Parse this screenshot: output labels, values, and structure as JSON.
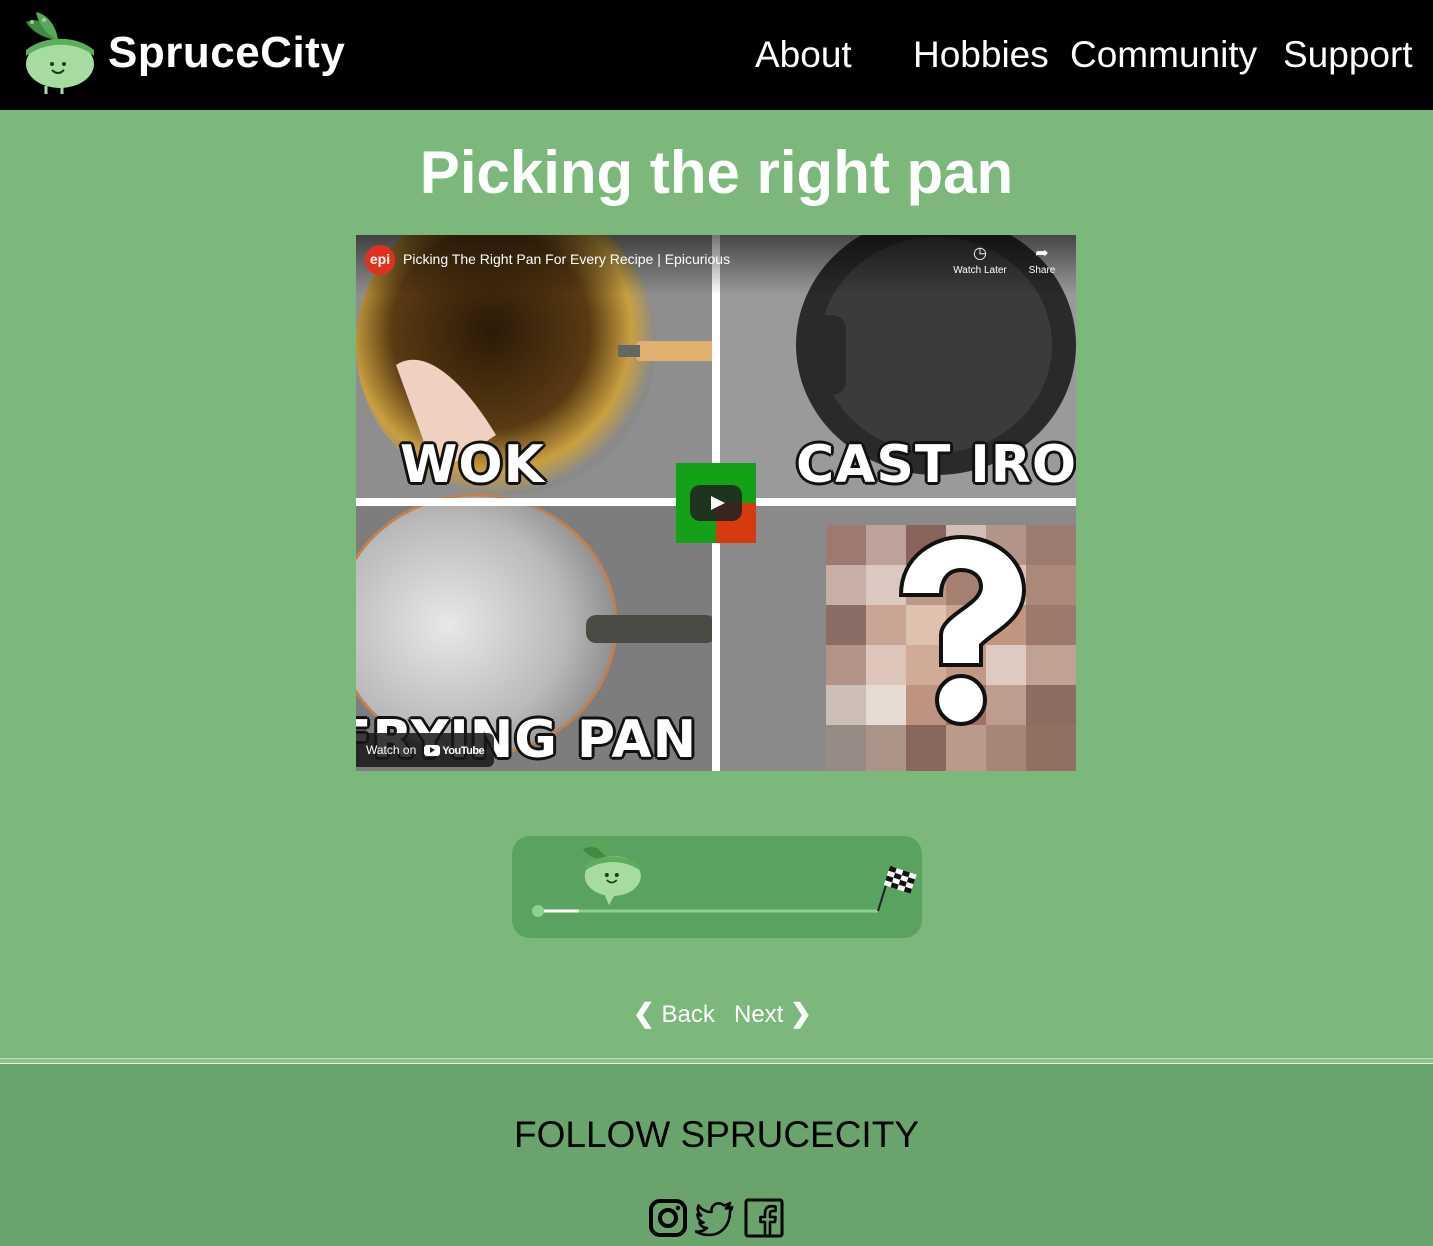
{
  "header": {
    "brand": "SpruceCity",
    "nav": [
      "About",
      "Hobbies",
      "Community",
      "Support"
    ]
  },
  "main": {
    "title": "Picking the right pan",
    "video": {
      "channel_badge": "epi",
      "title": "Picking The Right Pan For Every Recipe | Epicurious",
      "watch_later": "Watch Later",
      "share": "Share",
      "watch_on": "Watch on",
      "youtube": "YouTube",
      "quadrant_labels": [
        "WOK",
        "CAST IRON",
        "FRYING PAN",
        "?"
      ]
    },
    "progress": {
      "fraction": 0.12
    },
    "pager": {
      "back": "Back",
      "next": "Next"
    }
  },
  "footer": {
    "follow": "FOLLOW SPRUCECITY",
    "social_icons": [
      "instagram-icon",
      "twitter-icon",
      "facebook-icon"
    ]
  },
  "colors": {
    "page_bg": "#7cb87c",
    "header_bg": "#000000",
    "footer_bg": "#68a46c",
    "progress_bg": "#5aa260"
  }
}
